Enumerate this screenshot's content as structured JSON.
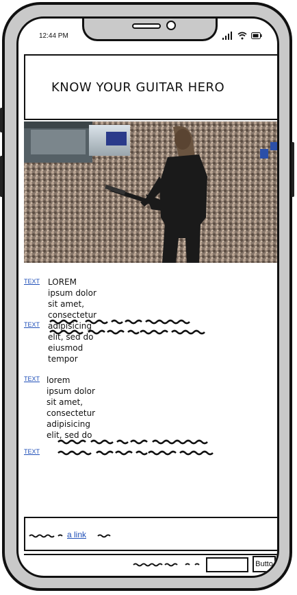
{
  "status": {
    "time": "12:44 PM"
  },
  "header": {
    "title": "KNOW YOUR GUITAR HERO"
  },
  "content": {
    "rows": [
      {
        "link": "TEXT",
        "text_line1": "LOREM ipsum dolor sit amet, consectetur",
        "text_line2": "adipisicing elit, sed do eiusmod tempor"
      },
      {
        "link": "TEXT"
      },
      {
        "link": "TEXT",
        "text_line1": "lorem ipsum dolor sit amet,",
        "text_line2": "consectetur adipisicing elit, sed do"
      },
      {
        "link": "TEXT"
      }
    ]
  },
  "footer": {
    "link": "a link"
  },
  "bottom": {
    "button_label": "Butto",
    "input_value": ""
  }
}
